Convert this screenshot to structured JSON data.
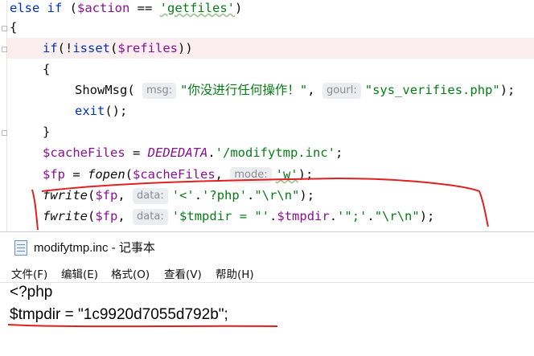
{
  "editor": {
    "lines": {
      "l1": {
        "kw1": "else",
        "kw2": "if",
        "p1": " (",
        "var": "$action",
        "op": " == ",
        "str": "'getfiles'",
        "p2": ")"
      },
      "l2": {
        "text": "{"
      },
      "l3": {
        "fn": "if",
        "p1": "(!",
        "fn2": "isset",
        "p2": "(",
        "var": "$refiles",
        "p3": "))"
      },
      "l4": {
        "text": "{"
      },
      "l5": {
        "fn": "ShowMsg",
        "p1": "(",
        "hint1": "msg:",
        "str1": "\"你没进行任何操作！\"",
        "comma": ",",
        "hint2": "gourl:",
        "str2": "\"sys_verifies.php\"",
        "p2": ");"
      },
      "l6": {
        "fn": "exit",
        "p": "();"
      },
      "l7": {
        "text": "}"
      },
      "l8": {
        "var": "$cacheFiles",
        "op": " = ",
        "const": "DEDEDATA",
        "dot": ".",
        "str": "'/modifytmp.inc'",
        "end": ";"
      },
      "l9": {
        "var": "$fp",
        "op": " = ",
        "fn": "fopen",
        "p1": "(",
        "arg": "$cacheFiles",
        "comma": ",",
        "hint": "mode:",
        "str": "'w'",
        "end": ");"
      },
      "l10": {
        "fn": "fwrite",
        "p1": "(",
        "arg": "$fp",
        "comma": ",",
        "hint": "data:",
        "s1": "'<'",
        "d1": ".",
        "s2": "'?php'",
        "d2": ".",
        "s3": "\"\\r\\n\"",
        "end": ");"
      },
      "l11": {
        "fn": "fwrite",
        "p1": "(",
        "arg": "$fp",
        "comma": ",",
        "hint": "data:",
        "s1": "'$tmpdir = \"'",
        "d1": ".",
        "var": "$tmpdir",
        "d2": ".",
        "s2": "'\";'",
        "d3": ".",
        "s3": "\"\\r\\n\"",
        "end": ");"
      }
    }
  },
  "notepad": {
    "title": "modifytmp.inc - 记事本",
    "menu": [
      "文件(F)",
      "编辑(E)",
      "格式(O)",
      "查看(V)",
      "帮助(H)"
    ],
    "content": [
      "<?php",
      "$tmpdir = \"1c9920d7055d792b\";"
    ]
  },
  "colors": {
    "keyword": "#0033b3",
    "variable": "#871094",
    "string": "#067d17",
    "annotation": "#e02020",
    "highlight": "#fbeeee"
  }
}
